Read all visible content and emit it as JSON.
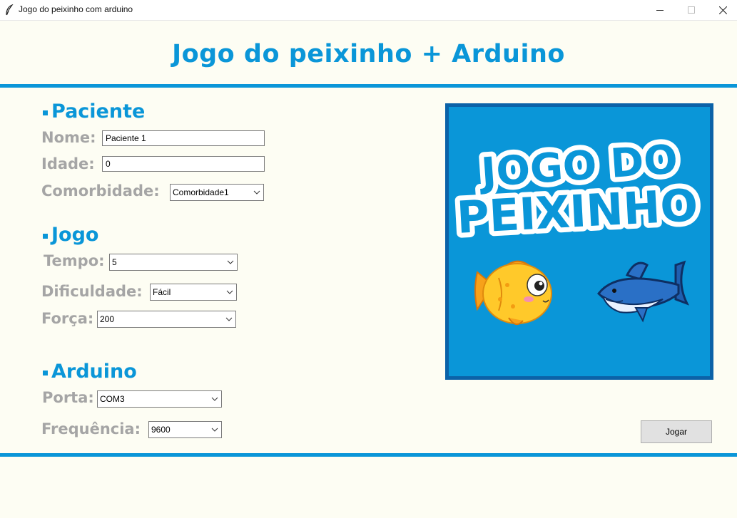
{
  "window": {
    "title": "Jogo do peixinho com arduino"
  },
  "header": {
    "title": "Jogo do peixinho + Arduino"
  },
  "colors": {
    "accent": "#0a96d8",
    "label_gray": "#a5a5a5",
    "background": "#fdfdf3",
    "image_border": "#0b62a8"
  },
  "paciente": {
    "heading": "Paciente",
    "nome_label": "Nome:",
    "nome_value": "Paciente 1",
    "idade_label": "Idade:",
    "idade_value": "0",
    "comorbidade_label": "Comorbidade:",
    "comorbidade_value": "Comorbidade1"
  },
  "jogo": {
    "heading": "Jogo",
    "tempo_label": "Tempo:",
    "tempo_value": "5",
    "dificuldade_label": "Dificuldade:",
    "dificuldade_value": "Fácil",
    "forca_label": "Força:",
    "forca_value": "200"
  },
  "arduino": {
    "heading": "Arduino",
    "porta_label": "Porta:",
    "porta_value": "COM3",
    "frequencia_label": "Frequência:",
    "frequencia_value": "9600"
  },
  "game_image": {
    "line1": "JOGO DO",
    "line2": "PEIXINHO"
  },
  "actions": {
    "play_label": "Jogar"
  }
}
